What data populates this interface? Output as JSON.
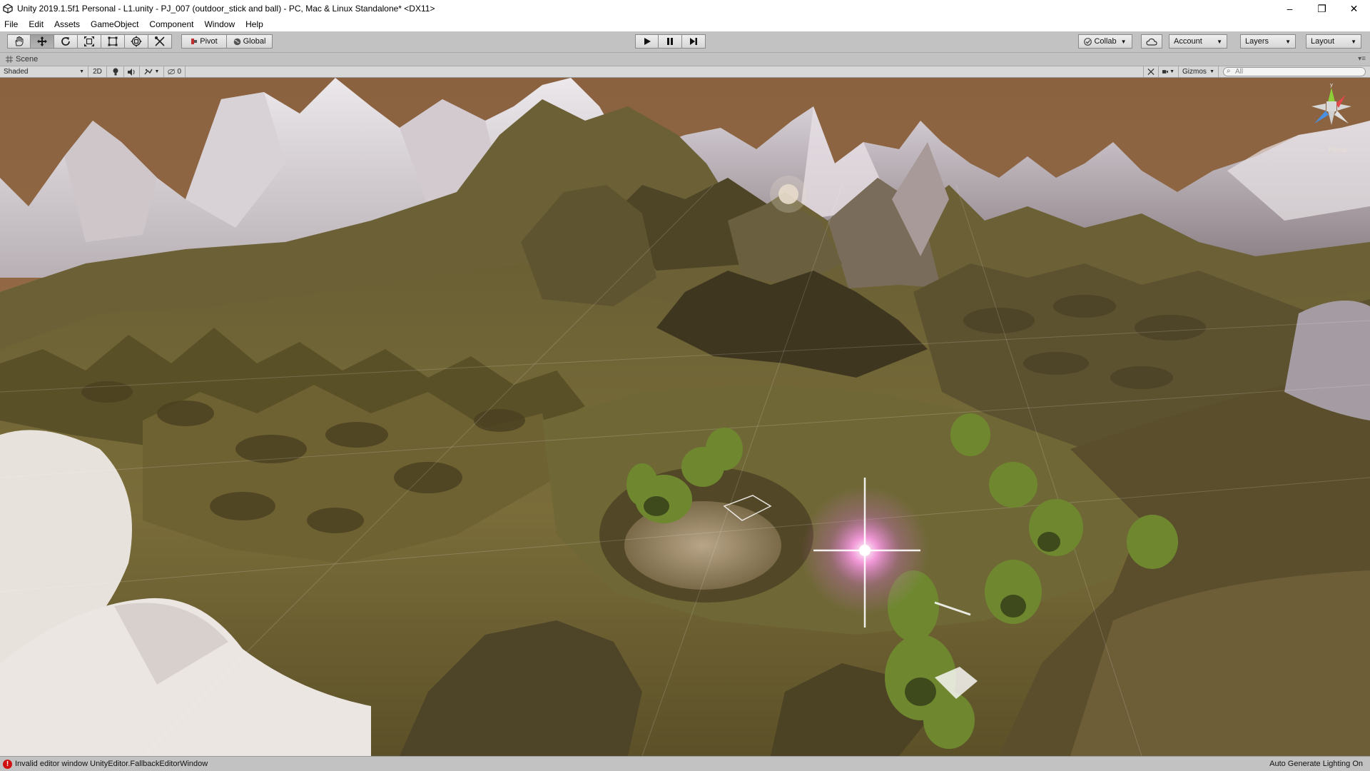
{
  "window": {
    "title": "Unity 2019.1.5f1 Personal - L1.unity - PJ_007 (outdoor_stick and  ball) - PC, Mac & Linux Standalone* <DX11>",
    "controls": [
      "–",
      "❐",
      "✕"
    ]
  },
  "menu": [
    "File",
    "Edit",
    "Assets",
    "GameObject",
    "Component",
    "Window",
    "Help"
  ],
  "toolbar": {
    "tools": [
      "hand-tool",
      "move-tool",
      "rotate-tool",
      "scale-tool",
      "rect-tool",
      "transform-tool",
      "custom-tool"
    ],
    "active_tool": "move-tool",
    "pivot_label": "Pivot",
    "global_label": "Global",
    "play_controls": [
      "play",
      "pause",
      "step"
    ],
    "collab_label": "Collab",
    "account_label": "Account",
    "layers_label": "Layers",
    "layout_label": "Layout"
  },
  "scene_tab": {
    "label": "Scene"
  },
  "scene_bar": {
    "shading_mode": "Shaded",
    "mode_2d_label": "2D",
    "hidden_count": "0",
    "gizmos_label": "Gizmos",
    "search_placeholder": "All"
  },
  "viewport": {
    "projection_label": "← Persp",
    "sky_color": "#8d6440"
  },
  "status": {
    "error_message": "Invalid editor window UnityEditor.FallbackEditorWindow",
    "right_text": "Auto Generate Lighting On"
  }
}
